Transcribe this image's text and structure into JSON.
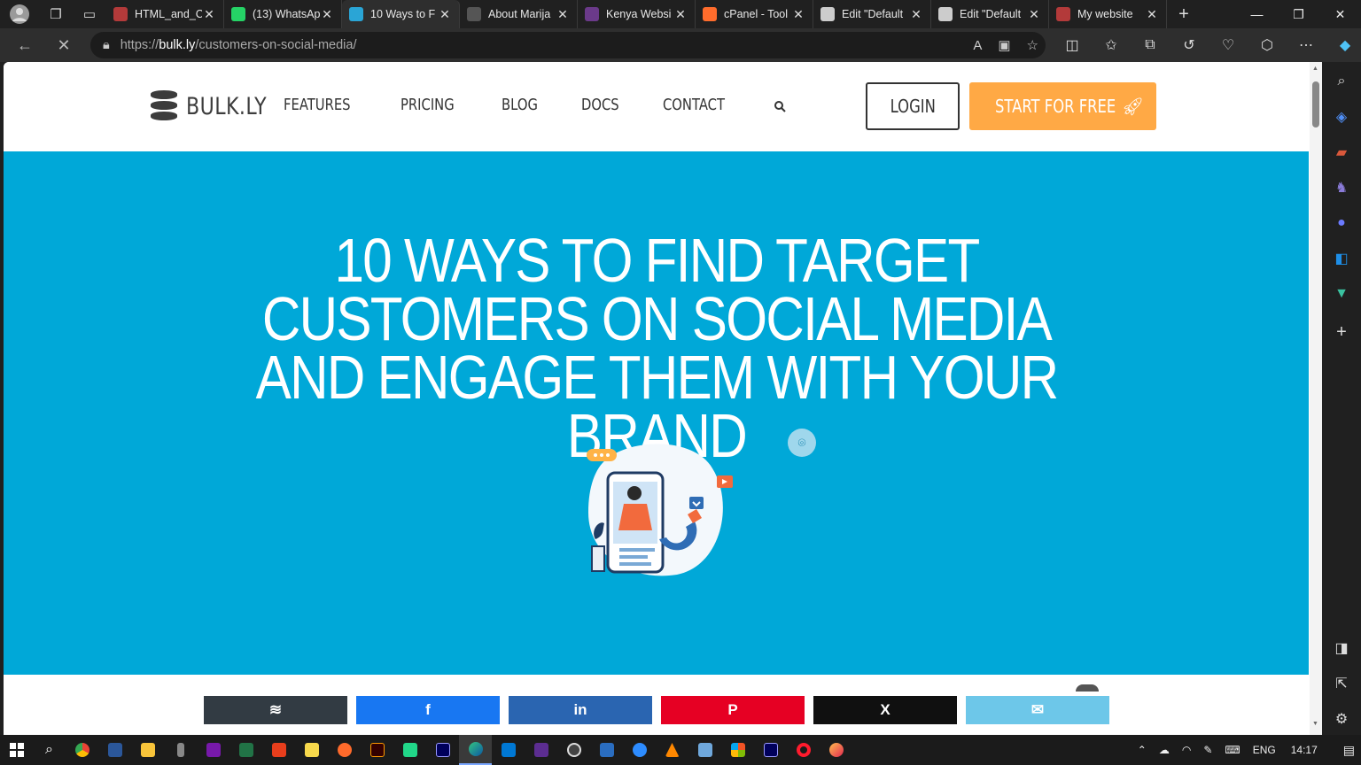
{
  "browser": {
    "tabs": [
      {
        "label": "HTML_and_C",
        "color": "#b33a3a"
      },
      {
        "label": "(13) WhatsAp",
        "color": "#25d366"
      },
      {
        "label": "10 Ways to F",
        "color": "#2aa5d6",
        "active": true
      },
      {
        "label": "About Marija",
        "color": "#555555"
      },
      {
        "label": "Kenya Websi",
        "color": "#6b3a8a"
      },
      {
        "label": "cPanel - Tool",
        "color": "#ff6c2c"
      },
      {
        "label": "Edit \"Default",
        "color": "#cccccc"
      },
      {
        "label": "Edit \"Default",
        "color": "#cccccc"
      },
      {
        "label": "My website",
        "color": "#b33a3a"
      }
    ],
    "url_prefix": "https://",
    "url_host": "bulk.ly",
    "url_path": "/customers-on-social-media/"
  },
  "site": {
    "logo_text": "BULK.LY",
    "nav": [
      "FEATURES",
      "PRICING",
      "BLOG",
      "DOCS",
      "CONTACT"
    ],
    "login_label": "LOGIN",
    "start_label": "START FOR FREE",
    "hero_title": "10 WAYS TO FIND TARGET CUSTOMERS ON SOCIAL MEDIA AND ENGAGE THEM WITH YOUR BRAND",
    "hero_bg": "#00a8d8",
    "accent": "#ffa945"
  },
  "share": [
    {
      "name": "buffer",
      "glyph": "≋",
      "color": "#323b43"
    },
    {
      "name": "facebook",
      "glyph": "f",
      "color": "#1877f2"
    },
    {
      "name": "linkedin",
      "glyph": "in",
      "color": "#2a65b1"
    },
    {
      "name": "pinterest",
      "glyph": "P",
      "color": "#e60023"
    },
    {
      "name": "x",
      "glyph": "X",
      "color": "#101010"
    },
    {
      "name": "email",
      "glyph": "✉",
      "color": "#6dc7e9"
    }
  ],
  "taskbar": {
    "language": "ENG",
    "time": "14:17"
  }
}
